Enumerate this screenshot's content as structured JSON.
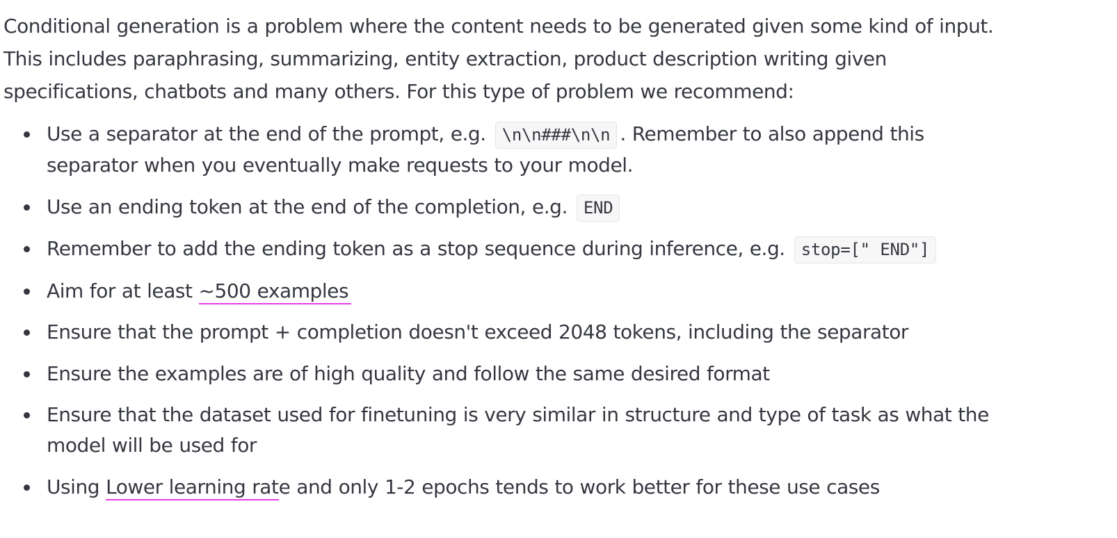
{
  "intro": {
    "line1": "Conditional generation is a problem where the content needs to be generated given some kind of input.",
    "line2": "This includes paraphrasing, summarizing, entity extraction, product description writing given",
    "line3": "specifications, chatbots and many others. For this type of problem we recommend:"
  },
  "bullets": [
    {
      "text_before": "Use a separator at the end of the prompt, e.g.",
      "code": "\\n\\n###\\n\\n",
      "text_after": ". Remember to also append this",
      "line2": "separator when you eventually make requests to your model."
    },
    {
      "text_before": "Use an ending token at the end of the completion, e.g.",
      "code": "END"
    },
    {
      "text_before": "Remember to add the ending token as a stop sequence during inference, e.g.",
      "code": "stop=[\" END\"]"
    },
    {
      "text_before": "Aim for at least",
      "highlight": "~500 examples"
    },
    {
      "text": "Ensure that the prompt + completion doesn't exceed 2048 tokens, including the separator"
    },
    {
      "text": "Ensure the examples are of high quality and follow the same desired format"
    },
    {
      "line1": "Ensure that the dataset used for finetuning is very similar in structure and type of task as what the",
      "line2": "model will be used for"
    },
    {
      "text_before": "Using",
      "highlight": "Lower learning rat",
      "text_after": "e and only 1-2 epochs tends to work better for these use cases"
    }
  ]
}
